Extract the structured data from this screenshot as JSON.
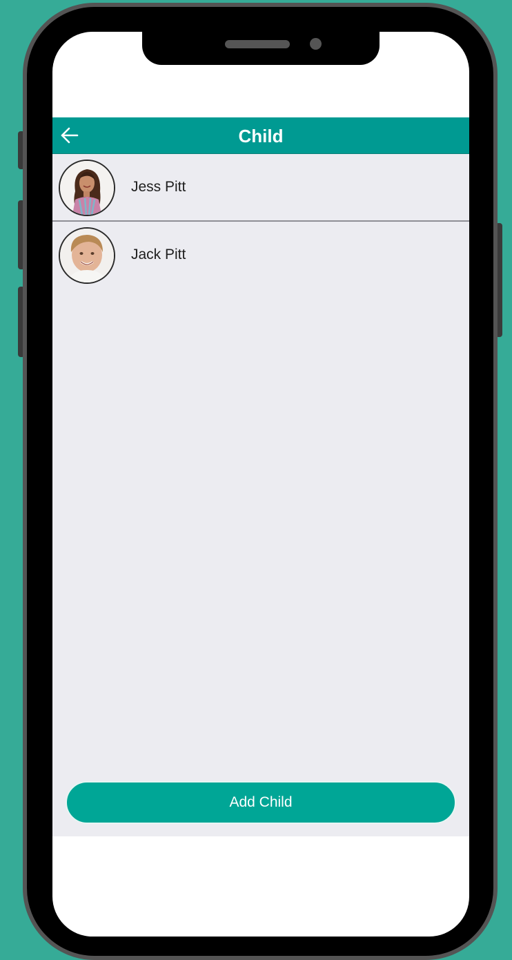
{
  "header": {
    "title": "Child",
    "back_icon": "arrow-left-icon"
  },
  "children": [
    {
      "name": "Jess Pitt",
      "avatar": "girl-photo"
    },
    {
      "name": "Jack Pitt",
      "avatar": "boy-photo"
    }
  ],
  "actions": {
    "add_child_label": "Add Child"
  },
  "colors": {
    "background": "#36ab97",
    "header": "#009a92",
    "button": "#00a696",
    "list_background": "#ececf1"
  }
}
